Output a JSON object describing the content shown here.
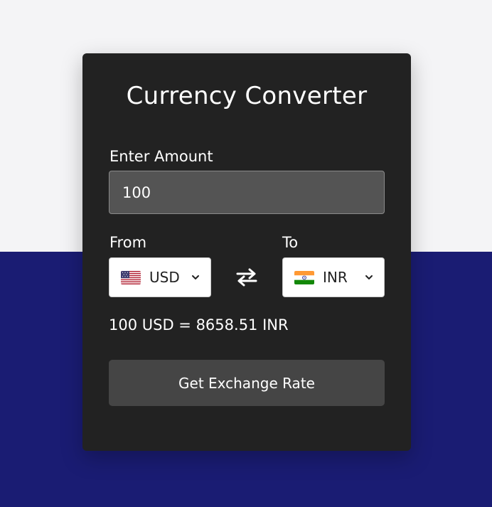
{
  "app": {
    "title": "Currency Converter"
  },
  "form": {
    "amount_label": "Enter Amount",
    "amount_value": "100",
    "from_label": "From",
    "to_label": "To",
    "from_currency": "USD",
    "from_flag": "us-flag-icon",
    "to_currency": "INR",
    "to_flag": "india-flag-icon",
    "swap_icon": "swap-arrows-icon",
    "result_text": "100 USD = 8658.51 INR",
    "button_label": "Get Exchange Rate"
  },
  "colors": {
    "page_top": "#f4f4f6",
    "page_bottom": "#1a1c73",
    "card": "#222222",
    "input": "#545454",
    "button": "#454545"
  }
}
